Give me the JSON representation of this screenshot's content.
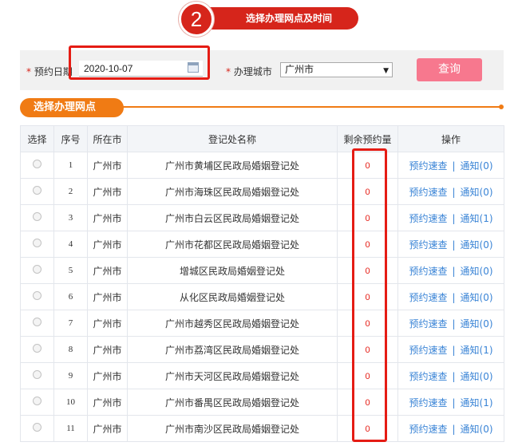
{
  "step": {
    "number": "2",
    "title": "选择办理网点及时间"
  },
  "search": {
    "date_label": "预约日期",
    "date_value": "2020-10-07",
    "city_label": "办理城市",
    "city_value": "广州市",
    "query_label": "查询",
    "required_mark": "*"
  },
  "section": {
    "title": "选择办理网点"
  },
  "table": {
    "headers": [
      "选择",
      "序号",
      "所在市",
      "登记处名称",
      "剩余预约量",
      "操作"
    ],
    "link_label": "预约速查",
    "separator": "|",
    "rows": [
      {
        "no": "1",
        "city": "广州市",
        "name": "广州市黄埔区民政局婚姻登记处",
        "remain": "0",
        "notify": "通知(0)"
      },
      {
        "no": "2",
        "city": "广州市",
        "name": "广州市海珠区民政局婚姻登记处",
        "remain": "0",
        "notify": "通知(0)"
      },
      {
        "no": "3",
        "city": "广州市",
        "name": "广州市白云区民政局婚姻登记处",
        "remain": "0",
        "notify": "通知(1)"
      },
      {
        "no": "4",
        "city": "广州市",
        "name": "广州市花都区民政局婚姻登记处",
        "remain": "0",
        "notify": "通知(0)"
      },
      {
        "no": "5",
        "city": "广州市",
        "name": "增城区民政局婚姻登记处",
        "remain": "0",
        "notify": "通知(0)"
      },
      {
        "no": "6",
        "city": "广州市",
        "name": "从化区民政局婚姻登记处",
        "remain": "0",
        "notify": "通知(0)"
      },
      {
        "no": "7",
        "city": "广州市",
        "name": "广州市越秀区民政局婚姻登记处",
        "remain": "0",
        "notify": "通知(0)"
      },
      {
        "no": "8",
        "city": "广州市",
        "name": "广州市荔湾区民政局婚姻登记处",
        "remain": "0",
        "notify": "通知(1)"
      },
      {
        "no": "9",
        "city": "广州市",
        "name": "广州市天河区民政局婚姻登记处",
        "remain": "0",
        "notify": "通知(0)"
      },
      {
        "no": "10",
        "city": "广州市",
        "name": "广州市番禺区民政局婚姻登记处",
        "remain": "0",
        "notify": "通知(1)"
      },
      {
        "no": "11",
        "city": "广州市",
        "name": "广州市南沙区民政局婚姻登记处",
        "remain": "0",
        "notify": "通知(0)"
      }
    ]
  },
  "colors": {
    "accent_red": "#d6251b",
    "orange": "#f07b14",
    "link_blue": "#3a84d6",
    "button_pink": "#f7788e",
    "highlight_red": "#e51c14"
  },
  "icons": {
    "calendar": "calendar-icon",
    "dropdown": "chevron-down-icon",
    "radio": "radio-button"
  }
}
